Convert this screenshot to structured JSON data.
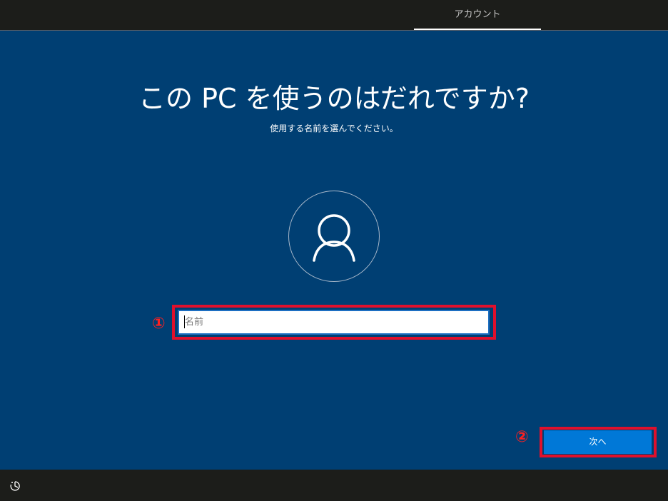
{
  "header": {
    "tab_label": "アカウント"
  },
  "main": {
    "title": "この PC を使うのはだれですか?",
    "subtitle": "使用する名前を選んでください。",
    "avatar_icon": "user-icon",
    "name_field": {
      "value": "",
      "placeholder": "名前"
    },
    "next_label": "次へ"
  },
  "annotations": {
    "marker_1": "①",
    "marker_2": "②",
    "highlight_color": "#e0102c"
  },
  "footer": {
    "accessibility_icon": "ease-of-access-icon"
  },
  "colors": {
    "background": "#003f73",
    "bar": "#1c1d1a",
    "primary_button": "#0078d7"
  }
}
